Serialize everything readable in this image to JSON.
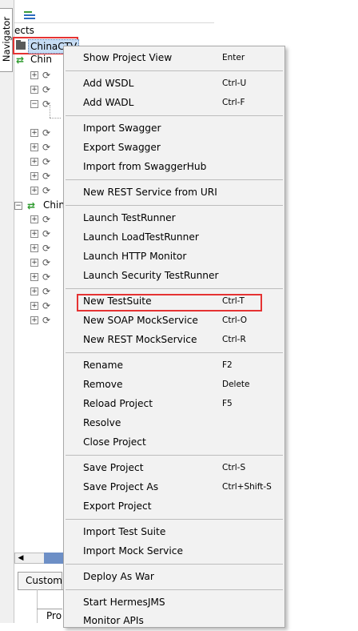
{
  "navigator_tab": {
    "label": "Navigator"
  },
  "tree": {
    "title": "ects",
    "root_label": "ChinaCTV",
    "interfaces": [
      {
        "label": "Chin"
      },
      {
        "label": "Chin"
      }
    ]
  },
  "bottom": {
    "tab_label": "Custom",
    "pane_text": "Pro"
  },
  "menu": {
    "items": [
      {
        "label": "Show Project View",
        "shortcut": "Enter"
      },
      {
        "label": "Add WSDL",
        "shortcut": "Ctrl-U"
      },
      {
        "label": "Add WADL",
        "shortcut": "Ctrl-F"
      },
      {
        "label": "Import Swagger",
        "shortcut": ""
      },
      {
        "label": "Export Swagger",
        "shortcut": ""
      },
      {
        "label": "Import from SwaggerHub",
        "shortcut": ""
      },
      {
        "label": "New REST Service from URI",
        "shortcut": ""
      },
      {
        "label": "Launch TestRunner",
        "shortcut": ""
      },
      {
        "label": "Launch LoadTestRunner",
        "shortcut": ""
      },
      {
        "label": "Launch HTTP Monitor",
        "shortcut": ""
      },
      {
        "label": "Launch Security TestRunner",
        "shortcut": ""
      },
      {
        "label": "New TestSuite",
        "shortcut": "Ctrl-T"
      },
      {
        "label": "New SOAP MockService",
        "shortcut": "Ctrl-O"
      },
      {
        "label": "New REST MockService",
        "shortcut": "Ctrl-R"
      },
      {
        "label": "Rename",
        "shortcut": "F2"
      },
      {
        "label": "Remove",
        "shortcut": "Delete"
      },
      {
        "label": "Reload Project",
        "shortcut": "F5"
      },
      {
        "label": "Resolve",
        "shortcut": ""
      },
      {
        "label": "Close Project",
        "shortcut": ""
      },
      {
        "label": "Save Project",
        "shortcut": "Ctrl-S"
      },
      {
        "label": "Save Project As",
        "shortcut": "Ctrl+Shift-S"
      },
      {
        "label": "Export Project",
        "shortcut": ""
      },
      {
        "label": "Import Test Suite",
        "shortcut": ""
      },
      {
        "label": "Import Mock Service",
        "shortcut": ""
      },
      {
        "label": "Deploy As War",
        "shortcut": ""
      },
      {
        "label": "Start HermesJMS",
        "shortcut": ""
      },
      {
        "label": "Monitor APIs",
        "shortcut": ""
      }
    ]
  },
  "colors": {
    "highlight_border": "#e53333",
    "selection_bg": "#c7ddf5",
    "interface_icon": "#2e9b2e"
  }
}
